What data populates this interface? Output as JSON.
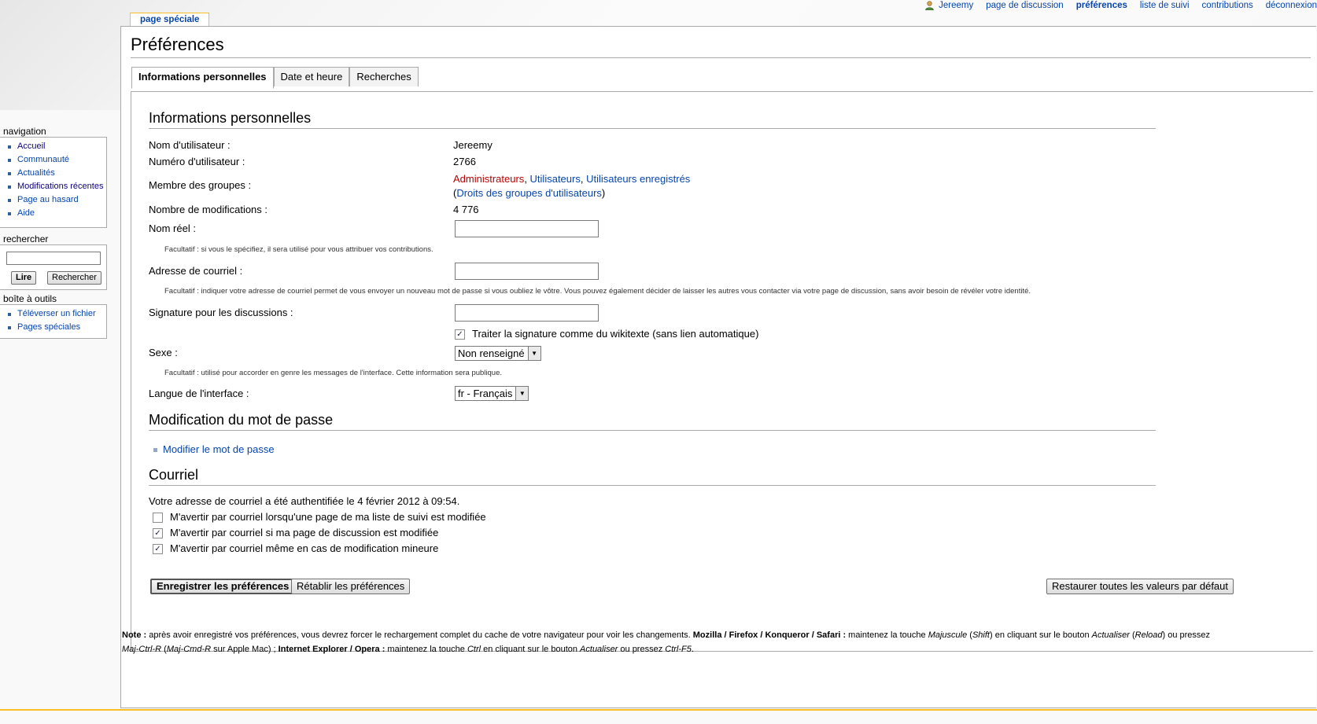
{
  "personal_tools": [
    {
      "label": "Jereemy",
      "icon": "user-icon"
    },
    {
      "label": "page de discussion"
    },
    {
      "label": "préférences",
      "active": true
    },
    {
      "label": "liste de suivi"
    },
    {
      "label": "contributions"
    },
    {
      "label": "déconnexion"
    }
  ],
  "page_tab": "page spéciale",
  "title": "Préférences",
  "tabs": [
    "Informations personnelles",
    "Date et heure",
    "Recherches"
  ],
  "personal": {
    "heading": "Informations personnelles",
    "username_label": "Nom d'utilisateur :",
    "username": "Jereemy",
    "userid_label": "Numéro d'utilisateur :",
    "userid": "2766",
    "groups_label": "Membre des groupes :",
    "group1": "Administrateurs",
    "sep1": ", ",
    "group2": "Utilisateurs",
    "sep2": ", ",
    "group3": "Utilisateurs enregistrés",
    "rights_open": "(",
    "rights_link": "Droits des groupes d'utilisateurs",
    "rights_close": ")",
    "edits_label": "Nombre de modifications :",
    "edits": "4 776",
    "realname_label": "Nom réel :",
    "realname_value": "",
    "realname_help": "Facultatif : si vous le spécifiez, il sera utilisé pour vous attribuer vos contributions.",
    "email_label": "Adresse de courriel :",
    "email_value": "",
    "email_help": "Facultatif : indiquer votre adresse de courriel permet de vous envoyer un nouveau mot de passe si vous oubliez le vôtre. Vous pouvez également décider de laisser les autres vous contacter via votre page de discussion, sans avoir besoin de révéler votre identité.",
    "signature_label": "Signature pour les discussions :",
    "signature_value": "",
    "fancysig_label": "Traiter la signature comme du wikitexte (sans lien automatique)",
    "fancysig_checked": true,
    "gender_label": "Sexe :",
    "gender_value": "Non renseigné",
    "gender_help": "Facultatif : utilisé pour accorder en genre les messages de l'interface. Cette information sera publique.",
    "language_label": "Langue de l'interface :",
    "language_value": "fr - Français"
  },
  "password": {
    "heading": "Modification du mot de passe",
    "link": "Modifier le mot de passe"
  },
  "email": {
    "heading": "Courriel",
    "auth_text": "Votre adresse de courriel a été authentifiée le 4 février 2012 à 09:54.",
    "opt1": "M'avertir par courriel lorsqu'une page de ma liste de suivi est modifiée",
    "opt1_checked": false,
    "opt2": "M'avertir par courriel si ma page de discussion est modifiée",
    "opt2_checked": true,
    "opt3": "M'avertir par courriel même en cas de modification mineure",
    "opt3_checked": true
  },
  "buttons": {
    "save": "Enregistrer les préférences",
    "reset": "Rétablir les préférences",
    "restore_all": "Restaurer toutes les valeurs par défaut"
  },
  "note": {
    "p1_bold": "Note :",
    "p1": " après avoir enregistré vos préférences, vous devrez forcer le rechargement complet du cache de votre navigateur pour voir les changements. ",
    "p2_bold": "Mozilla / Firefox / Konqueror / Safari :",
    "p2": " maintenez la touche ",
    "p2_i1": "Majuscule",
    "p2_b": " (",
    "p2_i2": "Shift",
    "p2_c": ") en cliquant sur le bouton ",
    "p2_i3": "Actualiser",
    "p2_d": " (",
    "p2_i4": "Reload",
    "p2_e": ") ou pressez ",
    "p2_i5": "Maj-Ctrl-R",
    "p2_f": " (",
    "p2_i6": "Maj-Cmd-R",
    "p2_g": " sur Apple Mac) ; ",
    "p3_bold": "Internet Explorer / Opera :",
    "p3": " maintenez la touche ",
    "p3_i1": "Ctrl",
    "p3_b": " en cliquant sur le bouton ",
    "p3_i2": "Actualiser",
    "p3_c": " ou pressez ",
    "p3_i3": "Ctrl-F5",
    "p3_d": "."
  },
  "sidebar": {
    "navigation_title": "navigation",
    "navigation": [
      "Accueil",
      "Communauté",
      "Actualités",
      "Modifications récentes",
      "Page au hasard",
      "Aide"
    ],
    "search_title": "rechercher",
    "search_go": "Lire",
    "search_button": "Rechercher",
    "tools_title": "boîte à outils",
    "tools": [
      "Téléverser un fichier",
      "Pages spéciales"
    ]
  }
}
